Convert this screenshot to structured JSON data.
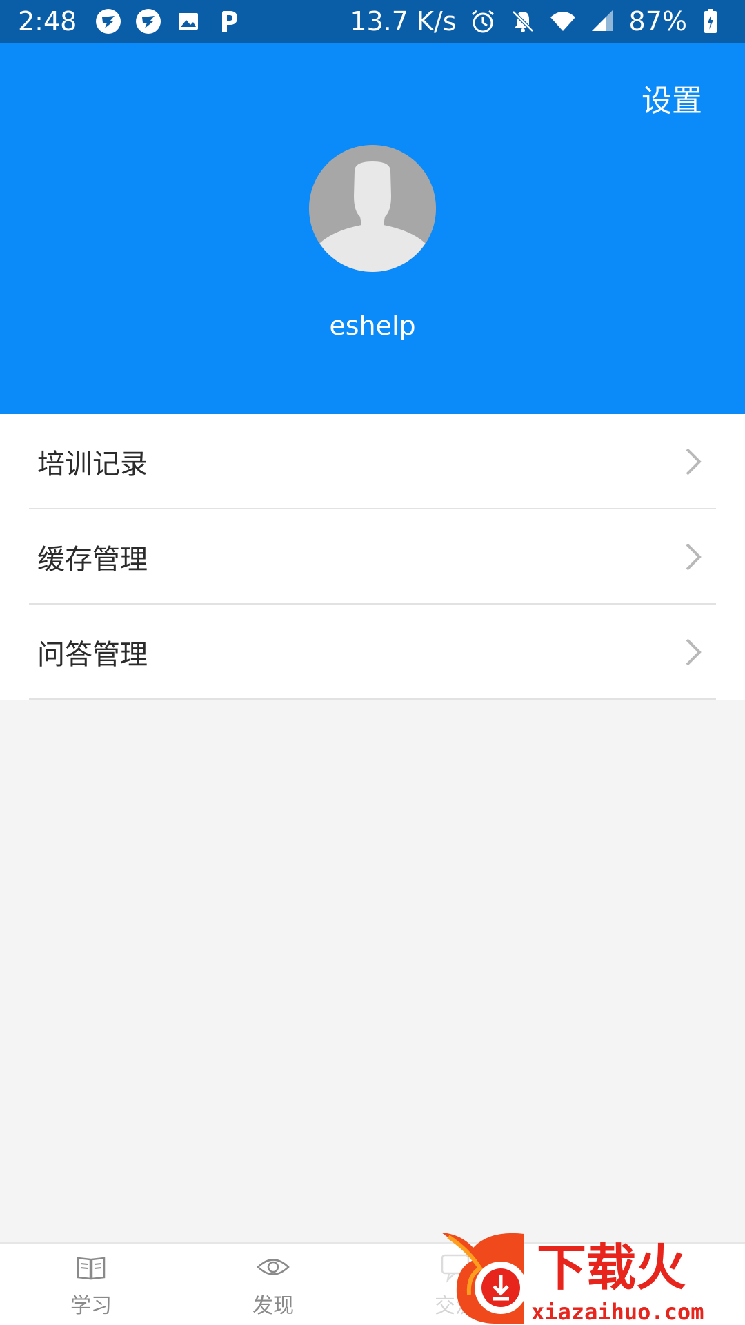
{
  "status_bar": {
    "time": "2:48",
    "network_speed": "13.7 K/s",
    "battery": "87%",
    "left_icons": [
      "dingtalk-icon",
      "dingtalk-icon",
      "image-icon",
      "p-icon"
    ],
    "right_icons": [
      "alarm-icon",
      "bell-off-icon",
      "wifi-icon",
      "signal-icon",
      "battery-icon"
    ]
  },
  "header": {
    "settings_label": "设置",
    "username": "eshelp",
    "background_color": "#0a8bf9"
  },
  "menu": {
    "items": [
      {
        "label": "培训记录"
      },
      {
        "label": "缓存管理"
      },
      {
        "label": "问答管理"
      }
    ]
  },
  "bottom_nav": {
    "items": [
      {
        "label": "学习",
        "icon": "book-icon"
      },
      {
        "label": "发现",
        "icon": "eye-icon"
      },
      {
        "label": "交流",
        "icon": "chat-icon"
      }
    ]
  },
  "watermark": {
    "title": "下载火",
    "url": "xiazaihuo.com"
  }
}
